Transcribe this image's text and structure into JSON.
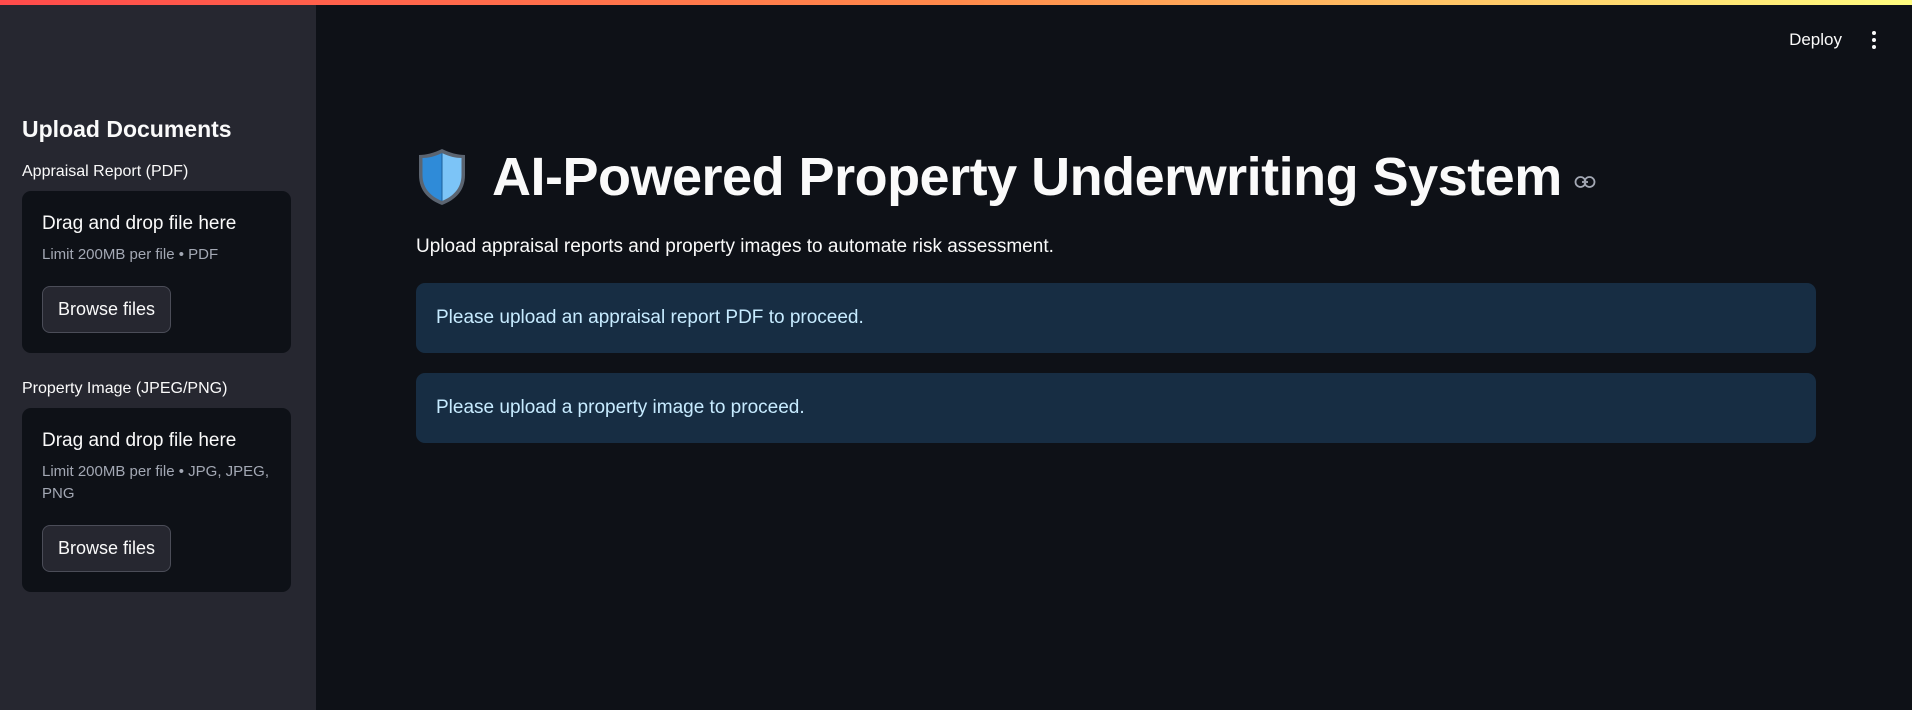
{
  "header": {
    "deploy_label": "Deploy",
    "menu_icon": "kebab-menu-icon"
  },
  "sidebar": {
    "heading": "Upload Documents",
    "uploaders": [
      {
        "label": "Appraisal Report (PDF)",
        "drag_text": "Drag and drop file here",
        "limit_text": "Limit 200MB per file • PDF",
        "button_label": "Browse files"
      },
      {
        "label": "Property Image (JPEG/PNG)",
        "drag_text": "Drag and drop file here",
        "limit_text": "Limit 200MB per file • JPG, JPEG, PNG",
        "button_label": "Browse files"
      }
    ]
  },
  "main": {
    "title_icon": "shield-icon",
    "title": "AI-Powered Property Underwriting System",
    "subtitle": "Upload appraisal reports and property images to automate risk assessment.",
    "alerts": [
      {
        "text": "Please upload an appraisal report PDF to proceed."
      },
      {
        "text": "Please upload a property image to proceed."
      }
    ]
  },
  "colors": {
    "background": "#0e1117",
    "sidebar": "#262730",
    "info_alert_bg": "#172d43",
    "info_alert_text": "#c7ebff"
  }
}
